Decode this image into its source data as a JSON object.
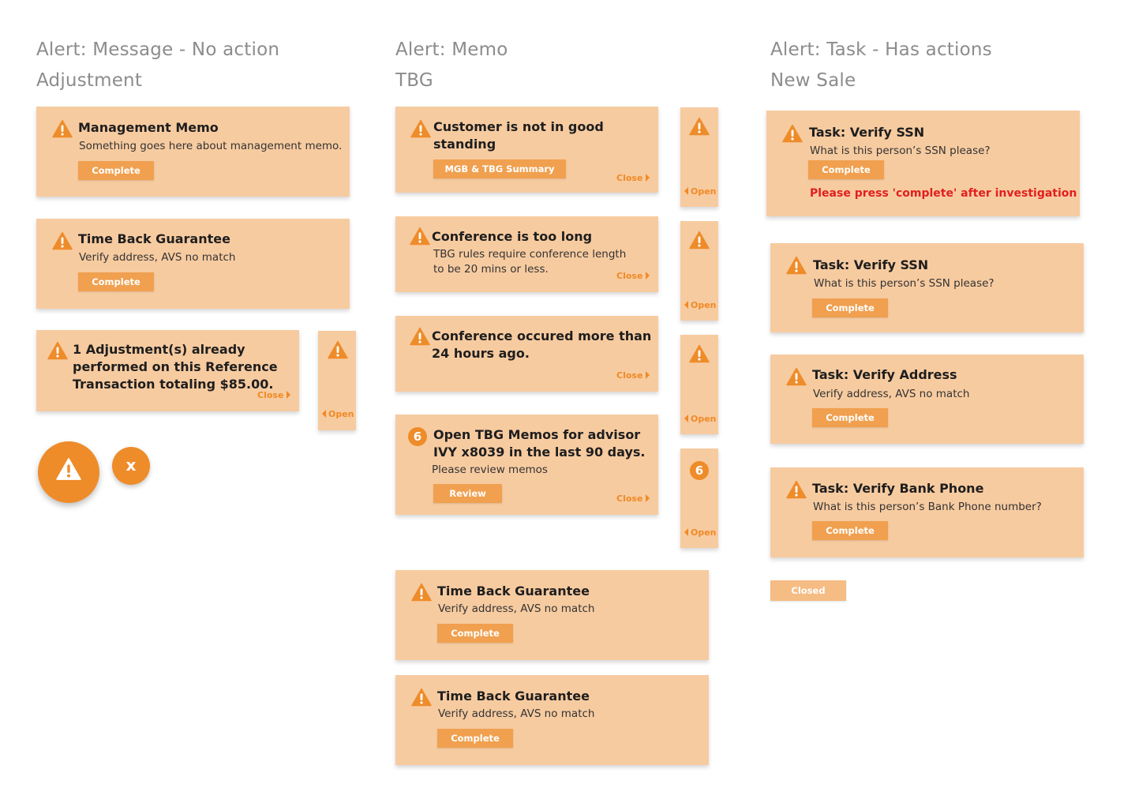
{
  "colors": {
    "card_bg": "#f7cba0",
    "accent": "#ee8c2a",
    "button": "#f0a04f",
    "warning_text": "#e02020",
    "heading": "#8c8c8c"
  },
  "col1": {
    "heading": "Alert: Message - No action",
    "subheading": "Adjustment",
    "card1": {
      "icon": "warning-icon",
      "title": "Management Memo",
      "body": "Something goes here about management memo.",
      "button": "Complete"
    },
    "card2": {
      "icon": "warning-icon",
      "title": "Time Back Guarantee",
      "body": "Verify address, AVS no match",
      "button": "Complete"
    },
    "card3": {
      "icon": "warning-icon",
      "title_l1": "1 Adjustment(s) already",
      "title_l2": "performed on this Reference",
      "title_l3": "Transaction totaling $85.00.",
      "close": "Close"
    },
    "tab": {
      "icon": "warning-icon",
      "open": "Open"
    },
    "fab": {
      "icon": "warning-icon"
    },
    "dismiss": {
      "label": "x"
    }
  },
  "col2": {
    "heading": "Alert: Memo",
    "subheading": "TBG",
    "card1": {
      "title_l1": "Customer is not in good",
      "title_l2": "standing",
      "button": "MGB & TBG Summary",
      "close": "Close"
    },
    "card2": {
      "title": "Conference is too long",
      "body_l1": "TBG rules require conference length",
      "body_l2": "to be 20 mins or less.",
      "close": "Close"
    },
    "card3": {
      "title_l1": "Conference occured more than",
      "title_l2": "24 hours ago.",
      "close": "Close"
    },
    "card4": {
      "badge": "6",
      "title_l1": "Open TBG Memos for advisor",
      "title_l2": "IVY x8039 in the last 90 days.",
      "body": "Please review memos",
      "button": "Review",
      "close": "Close"
    },
    "tabs": [
      {
        "open": "Open"
      },
      {
        "open": "Open"
      },
      {
        "open": "Open"
      },
      {
        "badge": "6",
        "open": "Open"
      }
    ],
    "card5": {
      "title": "Time Back Guarantee",
      "body": "Verify address, AVS no match",
      "button": "Complete"
    },
    "card6": {
      "title": "Time Back Guarantee",
      "body": "Verify address, AVS no match",
      "button": "Complete"
    }
  },
  "col3": {
    "heading": "Alert: Task - Has actions",
    "subheading": "New Sale",
    "card1": {
      "title": "Task: Verify SSN",
      "body": "What is this person’s SSN please?",
      "button": "Complete",
      "note": "Please press 'complete' after investigation"
    },
    "card2": {
      "title": "Task: Verify SSN",
      "body": "What is this person’s SSN please?",
      "button": "Complete"
    },
    "card3": {
      "title": "Task: Verify Address",
      "body": "Verify address, AVS no match",
      "button": "Complete"
    },
    "card4": {
      "title": "Task: Verify Bank Phone",
      "body": "What is this person’s Bank Phone number?",
      "button": "Complete"
    },
    "closed_button": "Closed"
  }
}
